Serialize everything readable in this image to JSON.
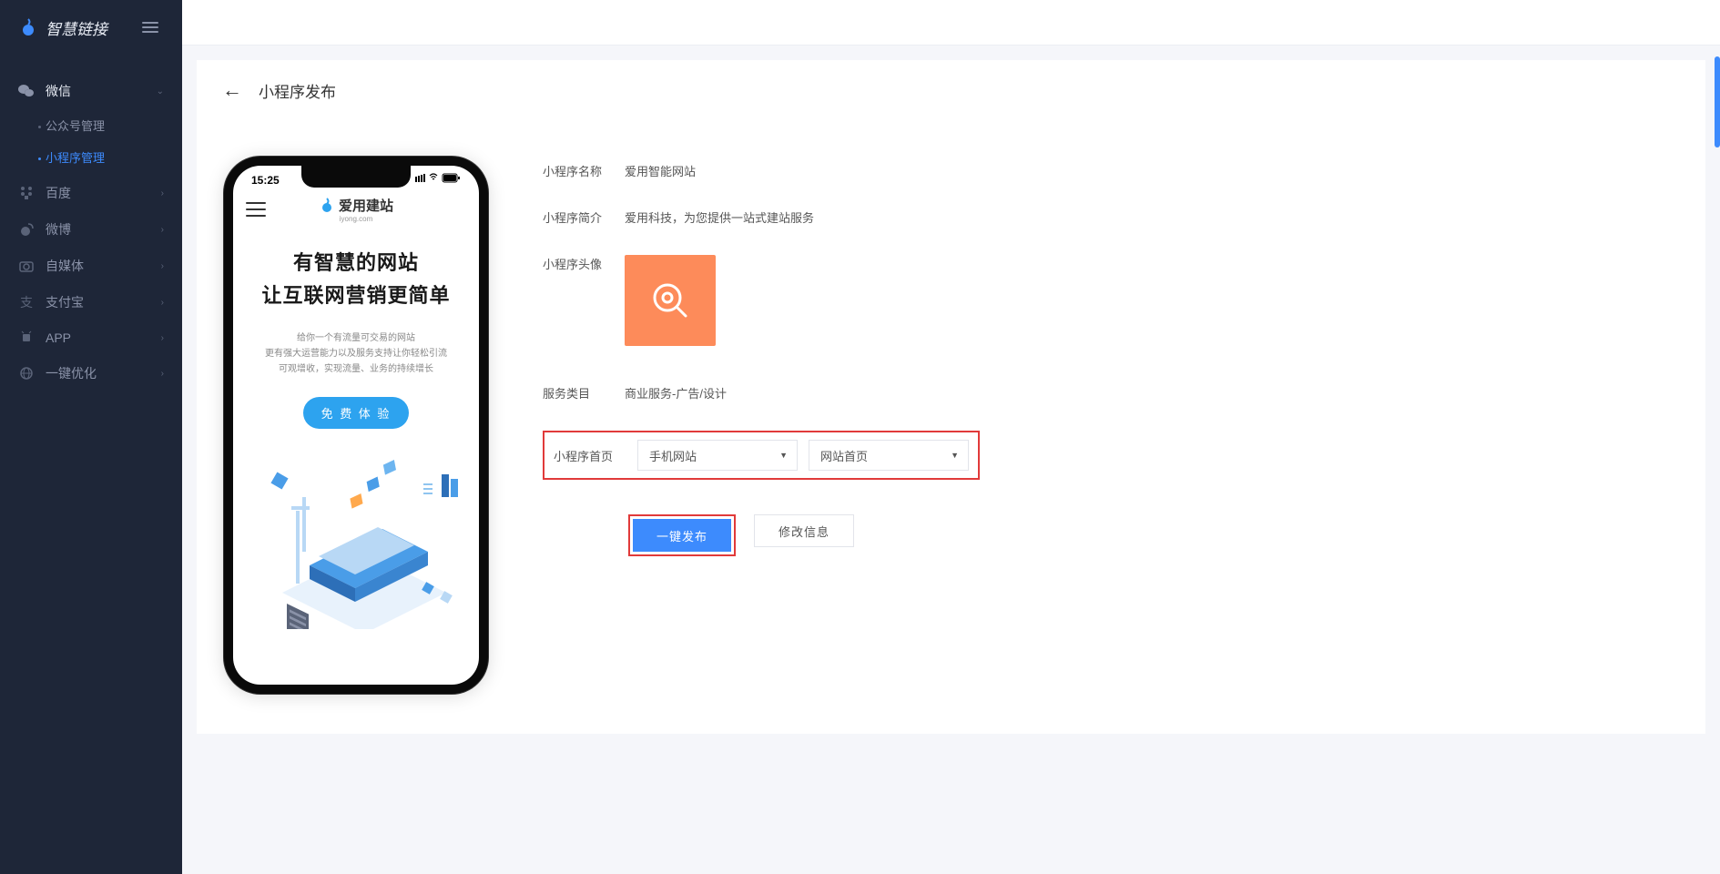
{
  "app": {
    "logo_text": "智慧链接"
  },
  "sidebar": {
    "items": [
      {
        "key": "wechat",
        "label": "微信",
        "expanded": true,
        "sub": [
          {
            "key": "gzh",
            "label": "公众号管理",
            "active": false
          },
          {
            "key": "xcx",
            "label": "小程序管理",
            "active": true
          }
        ]
      },
      {
        "key": "baidu",
        "label": "百度"
      },
      {
        "key": "weibo",
        "label": "微博"
      },
      {
        "key": "zimeiti",
        "label": "自媒体"
      },
      {
        "key": "alipay",
        "label": "支付宝"
      },
      {
        "key": "app",
        "label": "APP"
      },
      {
        "key": "seo",
        "label": "一键优化"
      }
    ]
  },
  "page": {
    "title": "小程序发布"
  },
  "phone": {
    "status_time": "15:25",
    "brand_name": "爱用建站",
    "brand_sub": "iyong.com",
    "heading1": "有智慧的网站",
    "heading2": "让互联网营销更简单",
    "desc1": "给你一个有流量可交易的网站",
    "desc2": "更有强大运营能力以及服务支持让你轻松引流",
    "desc3": "可观增收，实现流量、业务的持续增长",
    "cta": "免 费 体 验"
  },
  "form": {
    "name_label": "小程序名称",
    "name_value": "爱用智能网站",
    "intro_label": "小程序简介",
    "intro_value": "爱用科技，为您提供一站式建站服务",
    "avatar_label": "小程序头像",
    "category_label": "服务类目",
    "category_value": "商业服务-广告/设计",
    "homepage_label": "小程序首页",
    "select1_value": "手机网站",
    "select2_value": "网站首页",
    "publish_btn": "一键发布",
    "modify_btn": "修改信息"
  },
  "colors": {
    "accent": "#3d8bfd",
    "highlight": "#e13a3a",
    "avatar_bg": "#fd8b5a"
  }
}
